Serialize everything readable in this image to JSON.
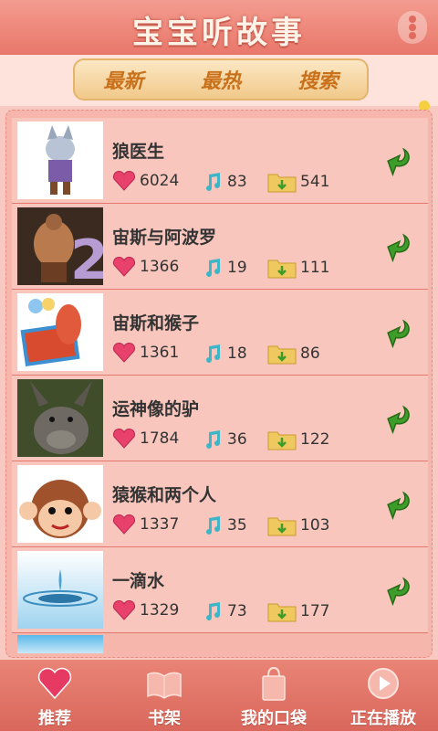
{
  "header": {
    "title": "宝宝听故事"
  },
  "tabs": [
    "最新",
    "最热",
    "搜索"
  ],
  "stories": [
    {
      "title": "狼医生",
      "likes": "6024",
      "plays": "83",
      "downloads": "541"
    },
    {
      "title": "宙斯与阿波罗",
      "likes": "1366",
      "plays": "19",
      "downloads": "111"
    },
    {
      "title": "宙斯和猴子",
      "likes": "1361",
      "plays": "18",
      "downloads": "86"
    },
    {
      "title": "运神像的驴",
      "likes": "1784",
      "plays": "36",
      "downloads": "122"
    },
    {
      "title": "猿猴和两个人",
      "likes": "1337",
      "plays": "35",
      "downloads": "103"
    },
    {
      "title": "一滴水",
      "likes": "1329",
      "plays": "73",
      "downloads": "177"
    }
  ],
  "bottom_nav": [
    "推荐",
    "书架",
    "我的口袋",
    "正在播放"
  ],
  "icons": {
    "likes": "heart-icon",
    "plays": "music-note-icon",
    "downloads": "folder-download-icon",
    "action": "green-download-arrow-icon"
  },
  "colors": {
    "header": "#e8776a",
    "list_bg": "#f8c6bc",
    "download_green": "#3e9c2a"
  }
}
